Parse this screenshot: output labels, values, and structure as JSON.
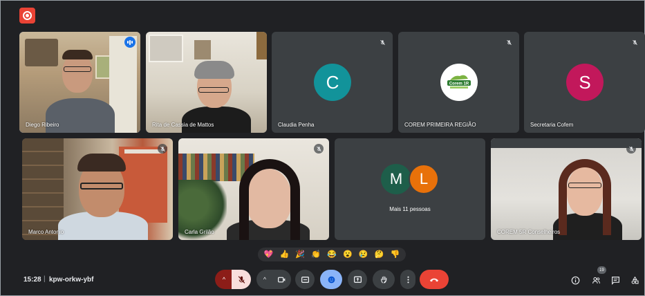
{
  "recording": {
    "icon": "record-icon"
  },
  "participants": [
    {
      "name": "Diego Ribeiro",
      "type": "video",
      "speaking": true
    },
    {
      "name": "Rita de Cassia de Mattos",
      "type": "video"
    },
    {
      "name": "Claudia Penha",
      "type": "avatar",
      "initial": "C",
      "color": "#12939a",
      "muted": true
    },
    {
      "name": "COREM PRIMEIRA REGIÃO",
      "type": "logo",
      "logo_text": "Corem 1R",
      "muted": true
    },
    {
      "name": "Secretaria Cofem",
      "type": "avatar",
      "initial": "S",
      "color": "#c2185b",
      "muted": true
    },
    {
      "name": "Marco Antonio",
      "type": "video",
      "muted": true
    },
    {
      "name": "Carla Grilão",
      "type": "video",
      "muted": true
    },
    {
      "name": "Mais 11 pessoas",
      "type": "group",
      "initials": [
        "M",
        "L"
      ],
      "colors": [
        "#1e5e4a",
        "#e8710a"
      ]
    },
    {
      "name": "COREM 5R Conselheiros",
      "type": "video",
      "muted": true
    }
  ],
  "reactions": [
    "💖",
    "👍",
    "🎉",
    "👏",
    "😂",
    "😮",
    "😢",
    "🤔",
    "👎"
  ],
  "footer": {
    "time": "15:28",
    "separator": "|",
    "meeting_code": "kpw-orkw-ybf",
    "participants_count": "19"
  },
  "colors": {
    "background": "#202124",
    "tile": "#3c4043",
    "end_call": "#ea4335",
    "active": "#8ab4f8",
    "mic_off": "#f9dedc"
  }
}
